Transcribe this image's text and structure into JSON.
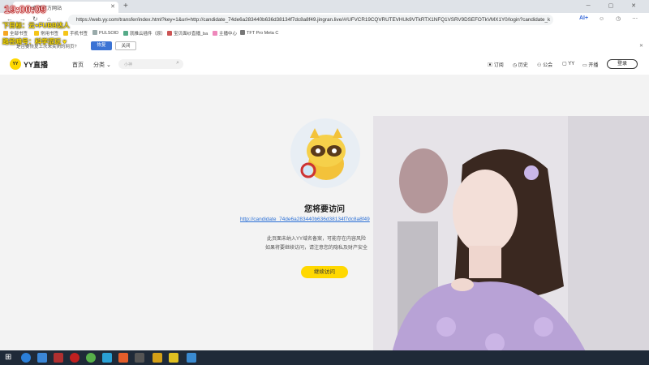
{
  "browser": {
    "tab_title": "YY直播官方网站",
    "new_tab": "+",
    "window_controls": "─ ▢ ✕",
    "url": "https://web.yy.com/transfer/index.html?key=1&url=http://candidate_74de6a283440b636d38134f7dc8a8f49.jingran.live/#/UFVCR19CQVRUTEVHUk9VTkRTX1NFQ1VSRV9DSEFOTkVMX1Y0/login?candidate_k",
    "ai_label": "AI+",
    "bookmarks": [
      "全部书签",
      "常用书签",
      "手机书签",
      "PULSOID",
      "就推云插件（原）",
      "宝贝面纱直播_ba",
      "主播中心",
      "TFT Pro Meta C"
    ],
    "restore_question": "是否要恢复上次未关闭的网页?",
    "restore_button": "恢复",
    "close_button": "关闭"
  },
  "site": {
    "logo_badge": "YY",
    "logo_text": "YY直播",
    "nav_home": "首页",
    "nav_category": "分类",
    "search_placeholder": "小神",
    "header_items": [
      "订阅",
      "历史",
      "公会",
      "YY",
      "开播"
    ],
    "login_button": "登录"
  },
  "content": {
    "title": "您将要访问",
    "link": "http://candidate_74de6a283440b636d38134f7dc8a8f49",
    "desc_line1": "此页面未纳入YY域名备案，可能存在内容风险",
    "desc_line2": "如果将要继续访问，请注意您的隐私及财产安全",
    "continue_button": "继续访问"
  },
  "overlay": {
    "clock": "19:00:09",
    "line1": "下目标：云+FUBB达人",
    "line2": "路径暗号：科学涩玩 ♥"
  },
  "colors": {
    "brand_yellow": "#ffd800",
    "link_blue": "#2a6fd6",
    "restore_blue": "#3b73d4"
  }
}
